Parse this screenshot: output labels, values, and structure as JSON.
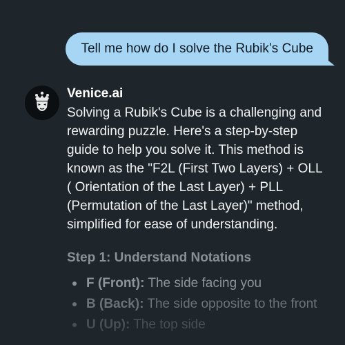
{
  "user_message": {
    "text": "Tell me how do I solve the Rubik’s Cube"
  },
  "assistant": {
    "name": "Venice.ai",
    "avatar_icon": "venice-logo-icon",
    "intro": "Solving a Rubik's Cube is a challenging and rewarding puzzle. Here's a step-by-step guide to help you solve it. This method is known as the \"F2L (First Two Layers) + OLL ( Orientation of the Last Layer) + PLL (Permutation of the Last Layer)\" method, simplified for ease of understanding.",
    "step_heading": "Step 1: Understand Notations",
    "bullets": [
      {
        "term": "F (Front):",
        "desc": " The side facing you"
      },
      {
        "term": "B (Back):",
        "desc": " The side opposite to the front"
      },
      {
        "term": "U (Up):",
        "desc": " The top side"
      }
    ]
  },
  "colors": {
    "background": "#1e252b",
    "user_bubble": "#a7d5f4",
    "assistant_text": "#f1f3f4"
  }
}
